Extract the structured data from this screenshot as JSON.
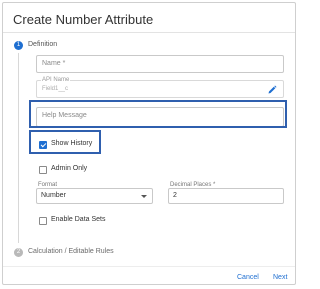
{
  "dialog": {
    "title": "Create Number Attribute"
  },
  "steps": [
    {
      "number": "1",
      "label": "Definition"
    },
    {
      "number": "2",
      "label": "Calculation / Editable Rules"
    }
  ],
  "form": {
    "name_placeholder": "Name *",
    "api_name_label": "API Name",
    "api_name_value": "Field1__c",
    "help_placeholder": "Help Message",
    "show_history_label": "Show History",
    "show_history_checked": true,
    "admin_only_label": "Admin Only",
    "admin_only_checked": false,
    "format_label": "Format",
    "format_value": "Number",
    "decimal_label": "Decimal Places *",
    "decimal_value": "2",
    "enable_datasets_label": "Enable Data Sets",
    "enable_datasets_checked": false
  },
  "footer": {
    "cancel_label": "Cancel",
    "next_label": "Next"
  },
  "colors": {
    "accent": "#1f6fd1",
    "highlight": "#2f5fae",
    "inactive_step": "#b9b9b9"
  },
  "icons": {
    "edit": "pencil-icon",
    "dropdown": "chevron-down-icon",
    "checkbox": "check-icon"
  }
}
